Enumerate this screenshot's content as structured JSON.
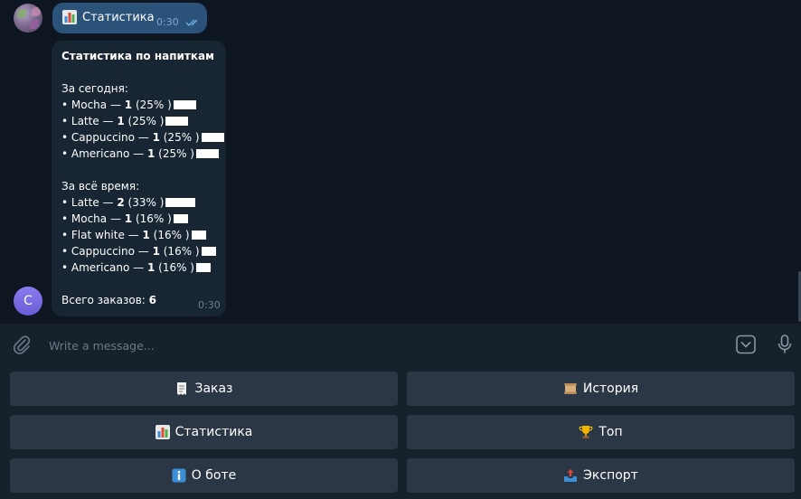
{
  "outgoing": {
    "text": "Статистика",
    "time": "0:30"
  },
  "incoming": {
    "title": "Статистика по напиткам",
    "today_header": "За сегодня:",
    "today": [
      {
        "prefix": "• Mocha — ",
        "count": "1",
        "pct": " (25% )",
        "fraction": 0.25
      },
      {
        "prefix": "• Latte — ",
        "count": "1",
        "pct": " (25% )",
        "fraction": 0.25
      },
      {
        "prefix": "• Cappuccino — ",
        "count": "1",
        "pct": " (25% )",
        "fraction": 0.25
      },
      {
        "prefix": "• Americano — ",
        "count": "1",
        "pct": " (25% )",
        "fraction": 0.25
      }
    ],
    "alltime_header": "За всё время:",
    "alltime": [
      {
        "prefix": "• Latte — ",
        "count": "2",
        "pct": " (33% )",
        "fraction": 0.33
      },
      {
        "prefix": "• Mocha — ",
        "count": "1",
        "pct": " (16% )",
        "fraction": 0.16
      },
      {
        "prefix": "• Flat white — ",
        "count": "1",
        "pct": " (16% )",
        "fraction": 0.16
      },
      {
        "prefix": "• Cappuccino — ",
        "count": "1",
        "pct": " (16% )",
        "fraction": 0.16
      },
      {
        "prefix": "• Americano — ",
        "count": "1",
        "pct": " (16% )",
        "fraction": 0.16
      }
    ],
    "total_label": "Всего заказов: ",
    "total_value": "6",
    "time": "0:30"
  },
  "bot_avatar_letter": "C",
  "composer": {
    "placeholder": "Write a message..."
  },
  "keyboard": {
    "buttons": [
      {
        "label": "Заказ",
        "icon": "receipt-icon"
      },
      {
        "label": "История",
        "icon": "scroll-icon"
      },
      {
        "label": "Статистика",
        "icon": "bar-chart-icon"
      },
      {
        "label": "Топ",
        "icon": "trophy-icon"
      },
      {
        "label": "О боте",
        "icon": "info-icon"
      },
      {
        "label": "Экспорт",
        "icon": "outbox-tray-icon"
      }
    ]
  },
  "colors": {
    "background": "#0e1621",
    "outgoing_bubble": "#2b5278",
    "incoming_bubble": "#182533",
    "button": "#2b3745",
    "panel": "#17212b"
  }
}
